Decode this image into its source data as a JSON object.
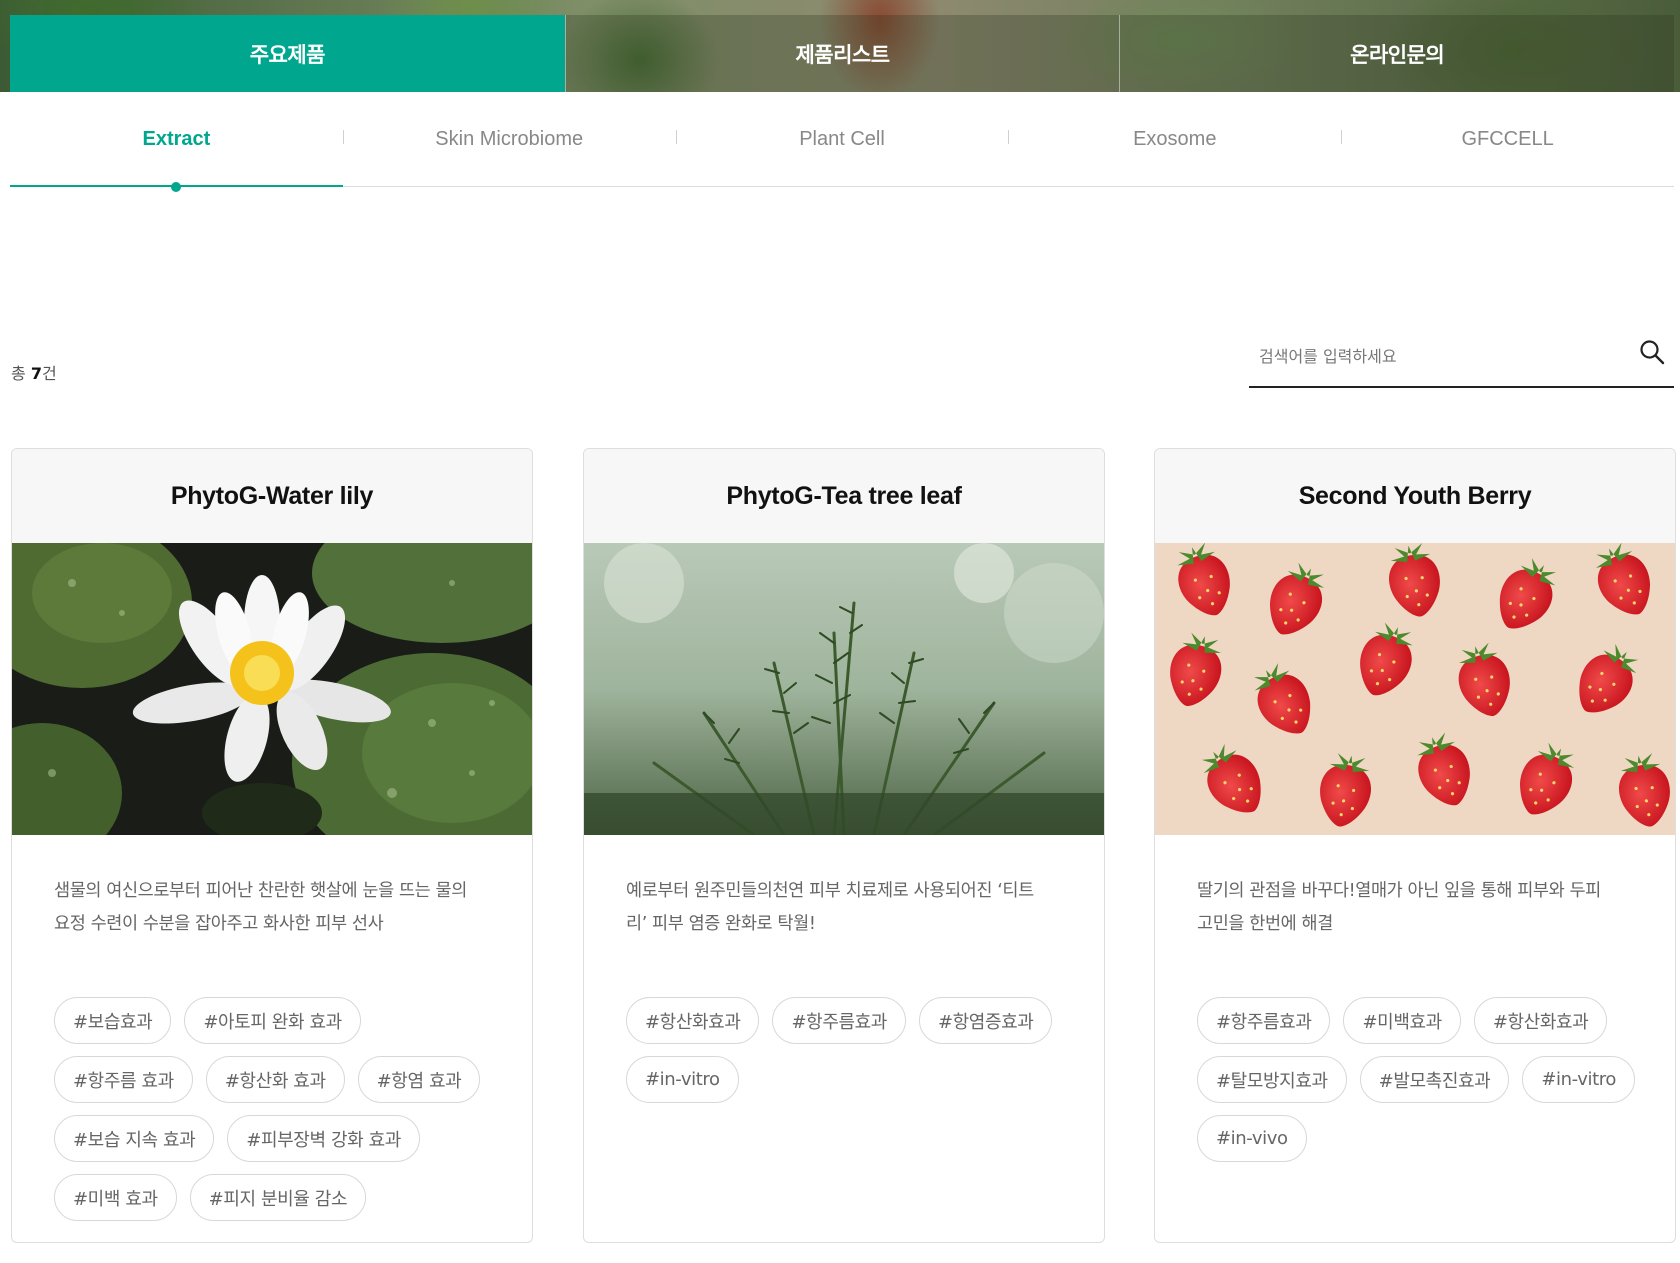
{
  "top_tabs": [
    {
      "label": "주요제품",
      "active": true
    },
    {
      "label": "제품리스트",
      "active": false
    },
    {
      "label": "온라인문의",
      "active": false
    }
  ],
  "sub_tabs": [
    {
      "label": "Extract",
      "active": true
    },
    {
      "label": "Skin Microbiome",
      "active": false
    },
    {
      "label": "Plant Cell",
      "active": false
    },
    {
      "label": "Exosome",
      "active": false
    },
    {
      "label": "GFCCELL",
      "active": false
    }
  ],
  "count": {
    "prefix": "총 ",
    "value": "7",
    "suffix": "건"
  },
  "search": {
    "placeholder": "검색어를 입력하세요",
    "icon": "search-icon"
  },
  "colors": {
    "accent": "#00a78e",
    "text": "#222222",
    "muted": "#666666",
    "border": "#dedede"
  },
  "cards": [
    {
      "title": "PhytoG-Water lily",
      "image": "water-lily-photo",
      "desc": [
        "샘물의 여신으로부터 피어난 찬란한 햇살에 눈을 뜨는 물의",
        "요정 수련이 수분을 잡아주고 화사한 피부 선사"
      ],
      "tags": [
        "#보습효과",
        "#아토피 완화 효과",
        "#항주름 효과",
        "#항산화 효과",
        "#항염 효과",
        "#보습 지속 효과",
        "#피부장벽 강화 효과",
        "#미백 효과",
        "#피지 분비율 감소"
      ]
    },
    {
      "title": "PhytoG-Tea tree leaf",
      "image": "tea-tree-leaf-photo",
      "desc": [
        "예로부터 원주민들의천연 피부 치료제로 사용되어진 ‘티트",
        "리’ 피부 염증 완화로 탁월!"
      ],
      "tags": [
        "#항산화효과",
        "#항주름효과",
        "#항염증효과",
        "#in-vitro"
      ]
    },
    {
      "title": "Second Youth Berry",
      "image": "strawberry-photo",
      "desc": [
        "딸기의 관점을 바꾸다!열매가 아닌 잎을 통해 피부와 두피",
        "고민을 한번에 해결"
      ],
      "tags": [
        "#항주름효과",
        "#미백효과",
        "#항산화효과",
        "#탈모방지효과",
        "#발모촉진효과",
        "#in-vitro",
        "#in-vivo"
      ]
    }
  ]
}
